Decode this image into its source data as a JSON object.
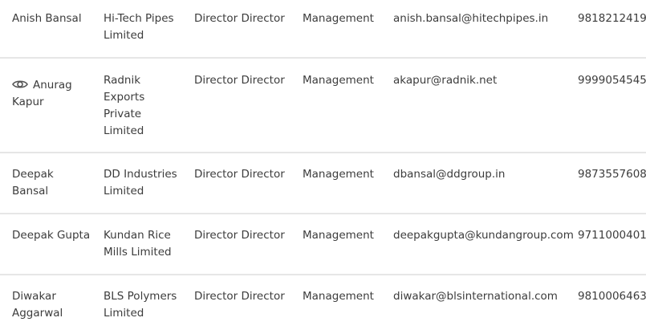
{
  "contacts": [
    {
      "name_lines": [
        "Anish Bansal"
      ],
      "company_lines": [
        "Hi-Tech Pipes",
        "Limited"
      ],
      "designation": "Director Director",
      "department": "Management",
      "email": "anish.bansal@hitechpipes.in",
      "phone": "9818212419",
      "viewed": false
    },
    {
      "name_lines": [
        "Anurag",
        "Kapur"
      ],
      "company_lines": [
        "Radnik",
        "Exports",
        "Private",
        "Limited"
      ],
      "designation": "Director Director",
      "department": "Management",
      "email": "akapur@radnik.net",
      "phone": "9999054545",
      "viewed": true,
      "icon": "eye-icon"
    },
    {
      "name_lines": [
        "Deepak Bansal"
      ],
      "company_lines": [
        "DD Industries",
        "Limited"
      ],
      "designation": "Director Director",
      "department": "Management",
      "email": "dbansal@ddgroup.in",
      "phone": "9873557608",
      "viewed": false
    },
    {
      "name_lines": [
        "Deepak Gupta"
      ],
      "company_lines": [
        "Kundan Rice",
        "Mills Limited"
      ],
      "designation": "Director Director",
      "department": "Management",
      "email": "deepakgupta@kundangroup.com",
      "phone": "9711000401",
      "viewed": false
    },
    {
      "name_lines": [
        "Diwakar",
        "Aggarwal"
      ],
      "company_lines": [
        "BLS Polymers",
        "Limited"
      ],
      "designation": "Director Director",
      "department": "Management",
      "email": "diwakar@blsinternational.com",
      "phone": "9810006463",
      "viewed": false
    }
  ],
  "colors": {
    "text": "#3c3c3c",
    "divider": "#e6e6e6",
    "icon": "#555555"
  }
}
